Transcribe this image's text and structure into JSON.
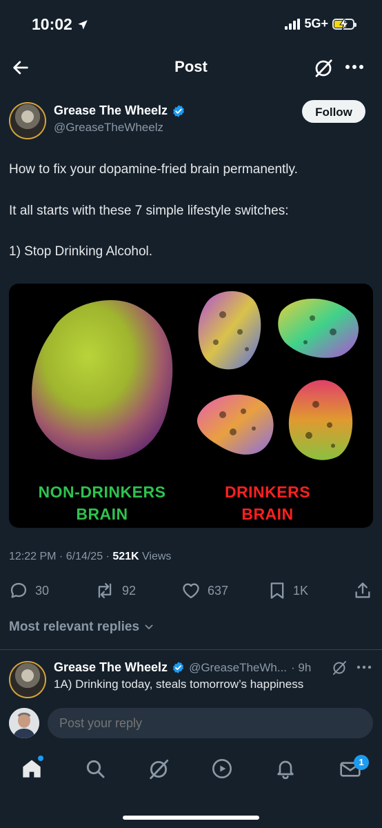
{
  "status_bar": {
    "time": "10:02",
    "network": "5G+"
  },
  "nav": {
    "title": "Post"
  },
  "author": {
    "name": "Grease The Wheelz",
    "handle": "@GreaseTheWheelz",
    "follow_label": "Follow"
  },
  "post": {
    "lines": [
      "How to fix your dopamine-fried brain permanently.",
      "It all starts with these 7 simple lifestyle switches:",
      "1) Stop Drinking Alcohol."
    ],
    "image": {
      "caption_left_line1": "NON-DRINKERS",
      "caption_left_line2": "BRAIN",
      "caption_right_line1": "DRINKERS",
      "caption_right_line2": "BRAIN"
    },
    "meta": {
      "time": "12:22 PM",
      "date": "6/14/25",
      "views_count": "521K",
      "views_label": "Views"
    }
  },
  "actions": {
    "replies": "30",
    "reposts": "92",
    "likes": "637",
    "bookmarks": "1K"
  },
  "replies_header": "Most relevant replies",
  "reply": {
    "name": "Grease The Wheelz",
    "handle": "@GreaseTheWh...",
    "time": "· 9h",
    "text": "1A) Drinking today, steals tomorrow’s happiness"
  },
  "compose": {
    "placeholder": "Post your reply"
  },
  "tabbar": {
    "messages_badge": "1"
  },
  "colors": {
    "background": "#15202b",
    "accent": "#1d9bf0",
    "verified": "#1d9bf0",
    "muted": "#8b98a5"
  },
  "icons": [
    "back-arrow-icon",
    "grok-icon",
    "more-icon",
    "verified-badge-icon",
    "reply-icon",
    "repost-icon",
    "like-icon",
    "bookmark-icon",
    "share-icon",
    "chevron-down-icon",
    "home-icon",
    "search-icon",
    "grok-icon",
    "video-icon",
    "bell-icon",
    "mail-icon"
  ]
}
